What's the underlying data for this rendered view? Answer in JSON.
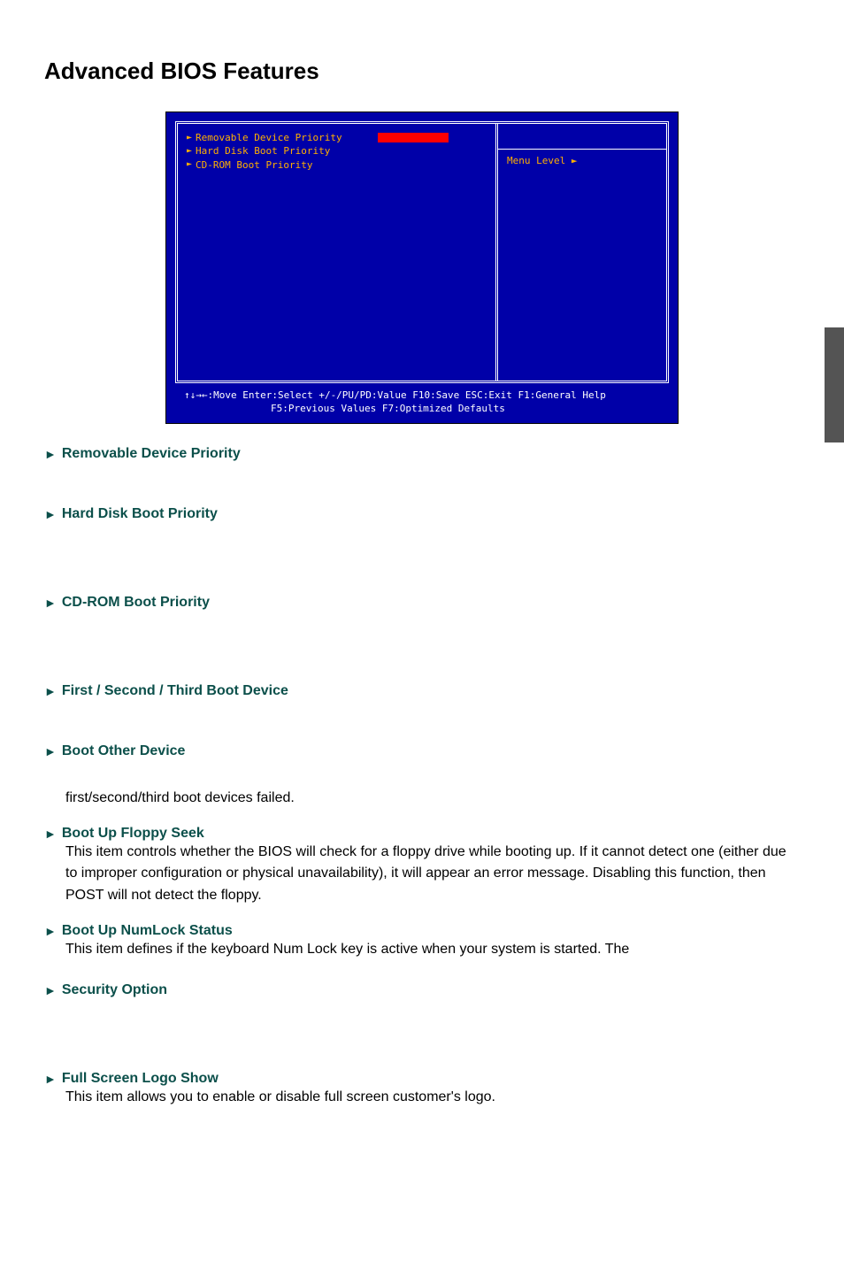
{
  "page": {
    "title": "Advanced BIOS Features"
  },
  "bios": {
    "menu": {
      "item1": "Removable Device Priority",
      "item2": "Hard Disk Boot Priority",
      "item3": "CD-ROM Boot Priority"
    },
    "help": {
      "label": "Menu Level  ►"
    },
    "footer": {
      "line1": "↑↓→←:Move   Enter:Select   +/-/PU/PD:Value   F10:Save    ESC:Exit   F1:General Help",
      "line2": "F5:Previous Values                    F7:Optimized Defaults"
    }
  },
  "sections": {
    "removable": {
      "title": "Removable Device Priority"
    },
    "hdd": {
      "title": "Hard Disk Boot Priority"
    },
    "cdrom": {
      "title": "CD-ROM Boot Priority"
    },
    "bootdev": {
      "title": "First / Second / Third Boot Device"
    },
    "bootother": {
      "title": "Boot Other Device",
      "body": "first/second/third boot devices failed."
    },
    "floppy": {
      "title": "Boot Up Floppy Seek",
      "body": "This item controls whether the BIOS will check for a floppy drive while booting up. If it cannot detect one (either due to improper configuration or physical unavailability), it will appear an error message. Disabling this function, then POST will not detect the floppy."
    },
    "numlock": {
      "title": "Boot Up NumLock Status",
      "body": "This item defines if the keyboard Num Lock key is active when your system is started. The"
    },
    "security": {
      "title": "Security Option"
    },
    "logo": {
      "title": "Full Screen Logo Show",
      "body": "This item allows you to enable or disable full screen customer's logo."
    }
  }
}
